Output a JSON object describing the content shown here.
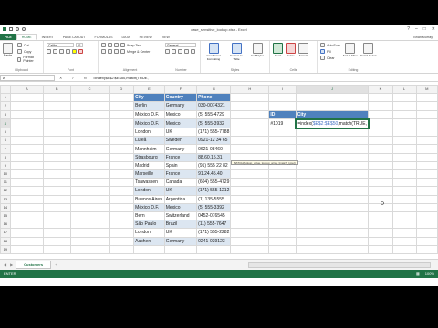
{
  "window": {
    "title": "case_sensitive_lookup.xlsx - Excel",
    "user": "Brian Murray",
    "controls": [
      "?",
      "–",
      "□",
      "✕"
    ]
  },
  "tabs": [
    "FILE",
    "HOME",
    "INSERT",
    "PAGE LAYOUT",
    "FORMULAS",
    "DATA",
    "REVIEW",
    "VIEW"
  ],
  "active_tab": "HOME",
  "ribbon": {
    "clipboard": {
      "paste": "Paste",
      "cut": "Cut",
      "copy": "Copy",
      "format_painter": "Format Painter",
      "label": "Clipboard"
    },
    "font": {
      "family": "Calibri",
      "size": "11",
      "label": "Font"
    },
    "alignment": {
      "wrap": "Wrap Text",
      "merge": "Merge & Center",
      "label": "Alignment"
    },
    "number": {
      "format": "General",
      "label": "Number"
    },
    "styles": {
      "conditional": "Conditional Formatting",
      "format_table": "Format as Table",
      "cell_styles": "Cell Styles",
      "label": "Styles"
    },
    "cells": {
      "insert": "Insert",
      "delete": "Delete",
      "format": "Format",
      "label": "Cells"
    },
    "editing": {
      "autosum": "AutoSum",
      "fill": "Fill",
      "clear": "Clear",
      "sort": "Sort & Filter",
      "find": "Find & Select",
      "label": "Editing"
    }
  },
  "formula_bar": {
    "name_box": "A",
    "formula": "=index($E$2:$E$50,match(TRUE,"
  },
  "columns": [
    "A",
    "B",
    "C",
    "D",
    "E",
    "F",
    "G",
    "H",
    "I",
    "J",
    "K",
    "L",
    "M"
  ],
  "headers": {
    "city": "City",
    "country": "Country",
    "phone": "Phone",
    "id": "ID",
    "city2": "City"
  },
  "rows": [
    [
      "Berlin",
      "Germany",
      "030-0074321"
    ],
    [
      "México D.F.",
      "Mexico",
      "(5) 555-4729"
    ],
    [
      "México D.F.",
      "Mexico",
      "(5) 555-3932"
    ],
    [
      "London",
      "UK",
      "(171) 555-7788"
    ],
    [
      "Luleå",
      "Sweden",
      "0921-12 34 65"
    ],
    [
      "Mannheim",
      "Germany",
      "0621-08460"
    ],
    [
      "Strasbourg",
      "France",
      "88.60.15.31"
    ],
    [
      "Madrid",
      "Spain",
      "(91) 555 22 82"
    ],
    [
      "Marseille",
      "France",
      "91.24.45.40"
    ],
    [
      "Tsawassen",
      "Canada",
      "(604) 555-4729"
    ],
    [
      "London",
      "UK",
      "(171) 555-1212"
    ],
    [
      "Buenos Aires",
      "Argentina",
      "(1) 135-5555"
    ],
    [
      "México D.F.",
      "Mexico",
      "(5) 555-3392"
    ],
    [
      "Bern",
      "Switzerland",
      "0452-076545"
    ],
    [
      "São Paulo",
      "Brazil",
      "(11) 555-7647"
    ],
    [
      "London",
      "UK",
      "(171) 555-2282"
    ],
    [
      "Aachen",
      "Germany",
      "0241-039123"
    ]
  ],
  "row_numbers": [
    "1",
    "2",
    "3",
    "4",
    "5",
    "6",
    "7",
    "8",
    "9",
    "10",
    "11",
    "12",
    "13",
    "14",
    "15",
    "16",
    "17",
    "18",
    "19"
  ],
  "lookup": {
    "id_value": "#1019",
    "formula_cell": "=index($E$2:$E$50,match(TRUE,",
    "tooltip": "MATCH(lookup_value, lookup_array, [match_type])"
  },
  "sheet": {
    "name": "Customers",
    "add": "+"
  },
  "status": {
    "mode": "ENTER",
    "zoom": "100%"
  },
  "colors": {
    "excel_green": "#217346",
    "table_header": "#4f81bd",
    "table_band": "#dce6f1"
  }
}
